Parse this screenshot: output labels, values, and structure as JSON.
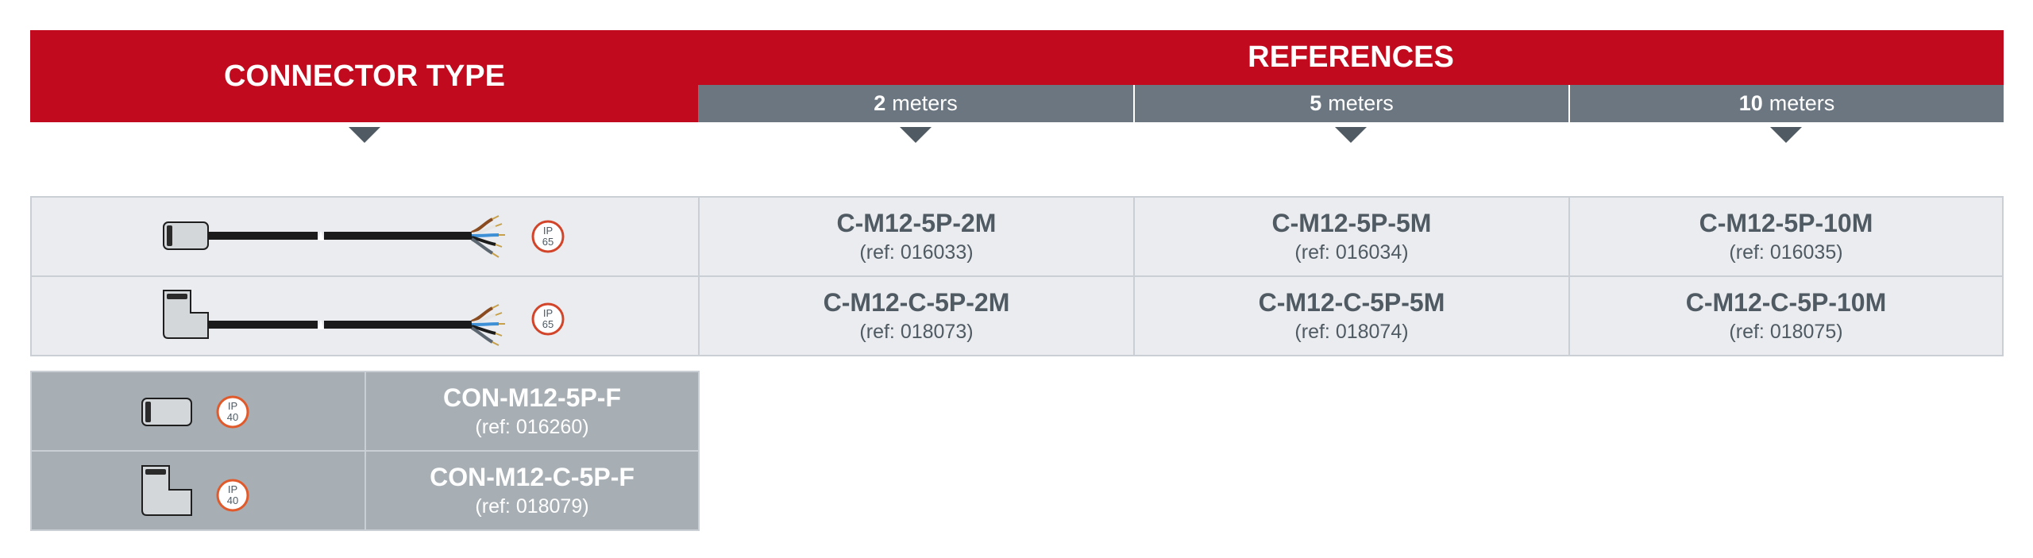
{
  "header": {
    "connector_type": "CONNECTOR TYPE",
    "references": "REFERENCES",
    "lengths": [
      {
        "value": "2",
        "unit": "meters"
      },
      {
        "value": "5",
        "unit": "meters"
      },
      {
        "value": "10",
        "unit": "meters"
      }
    ]
  },
  "cables": [
    {
      "connector": "straight",
      "ip": {
        "top": "IP",
        "bottom": "65"
      },
      "cells": [
        {
          "code": "C-M12-5P-2M",
          "ref": "(ref: 016033)"
        },
        {
          "code": "C-M12-5P-5M",
          "ref": "(ref: 016034)"
        },
        {
          "code": "C-M12-5P-10M",
          "ref": "(ref: 016035)"
        }
      ]
    },
    {
      "connector": "angled",
      "ip": {
        "top": "IP",
        "bottom": "65"
      },
      "cells": [
        {
          "code": "C-M12-C-5P-2M",
          "ref": "(ref: 018073)"
        },
        {
          "code": "C-M12-C-5P-5M",
          "ref": "(ref: 018074)"
        },
        {
          "code": "C-M12-C-5P-10M",
          "ref": "(ref: 018075)"
        }
      ]
    }
  ],
  "connectors": [
    {
      "connector": "straight",
      "ip": {
        "top": "IP",
        "bottom": "40"
      },
      "code": "CON-M12-5P-F",
      "ref": "(ref: 016260)"
    },
    {
      "connector": "angled",
      "ip": {
        "top": "IP",
        "bottom": "40"
      },
      "code": "CON-M12-C-5P-F",
      "ref": "(ref: 018079)"
    }
  ],
  "colors": {
    "header_red": "#c10a1e",
    "header_grey": "#6b7680",
    "cell_bg": "#eaecef",
    "connector_bg": "#a7afb5",
    "text_dark": "#4f5a63",
    "ip_ring": "#e05a2b"
  }
}
